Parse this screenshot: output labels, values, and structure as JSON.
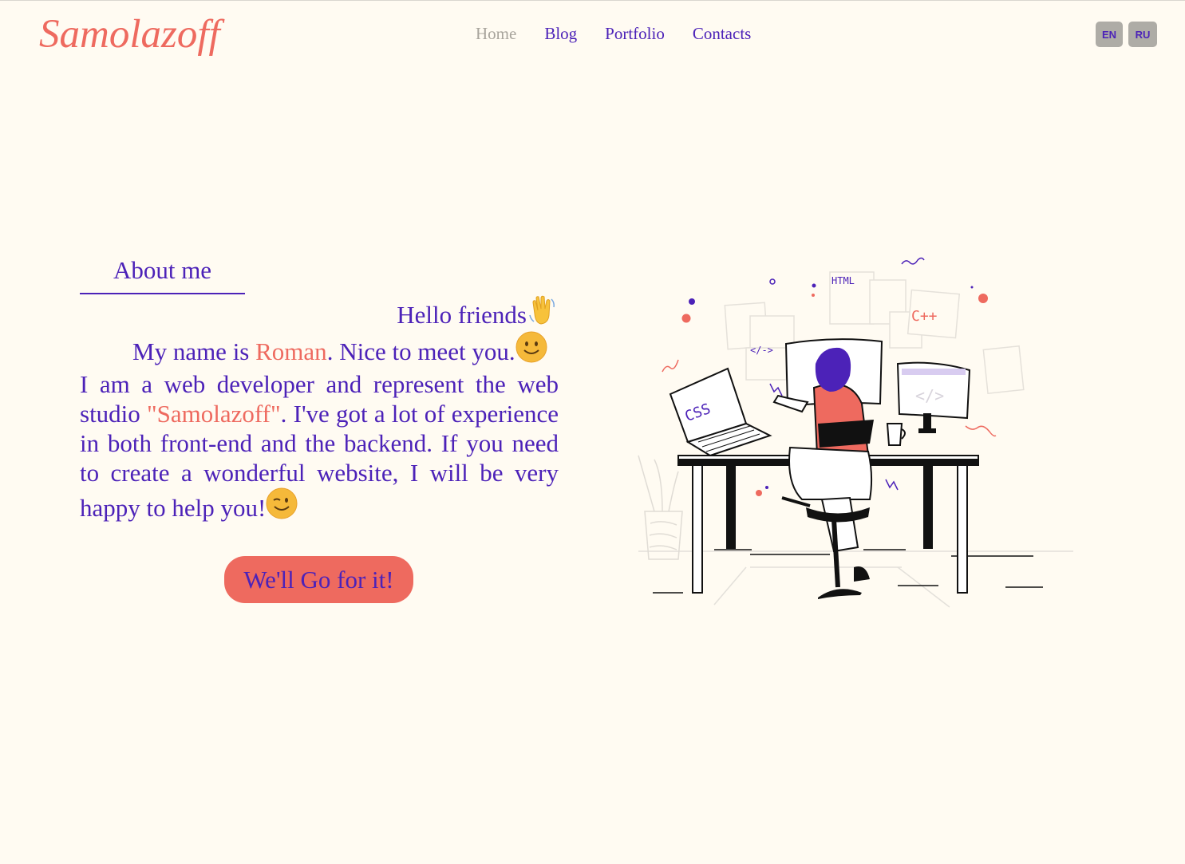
{
  "header": {
    "logo": "Samolazoff",
    "nav": [
      {
        "label": "Home",
        "active": true
      },
      {
        "label": "Blog"
      },
      {
        "label": "Portfolio"
      },
      {
        "label": "Contacts"
      }
    ],
    "languages": [
      "EN",
      "RU"
    ]
  },
  "about": {
    "title": "About me",
    "greeting": "Hello friends",
    "line1_prefix": "My name is ",
    "name": "Roman",
    "line1_suffix": ". Nice to meet you.",
    "line2_prefix": "I am a web developer and represent the web studio ",
    "studio": "\"Samolazoff\"",
    "line2_suffix": ". I've got a lot of experience in both front-end and the backend. If you need to create a wonderful website, I will be very happy to help you!",
    "cta": "We'll Go for it!"
  },
  "illustration": {
    "labels": [
      "HTML",
      "C++",
      "CSS",
      "</->"
    ],
    "icons": [
      "waving-hand-icon",
      "smile-icon",
      "wink-icon"
    ]
  },
  "colors": {
    "primary": "#4c22b8",
    "accent": "#ee6a5f",
    "background": "#fffbf2"
  }
}
